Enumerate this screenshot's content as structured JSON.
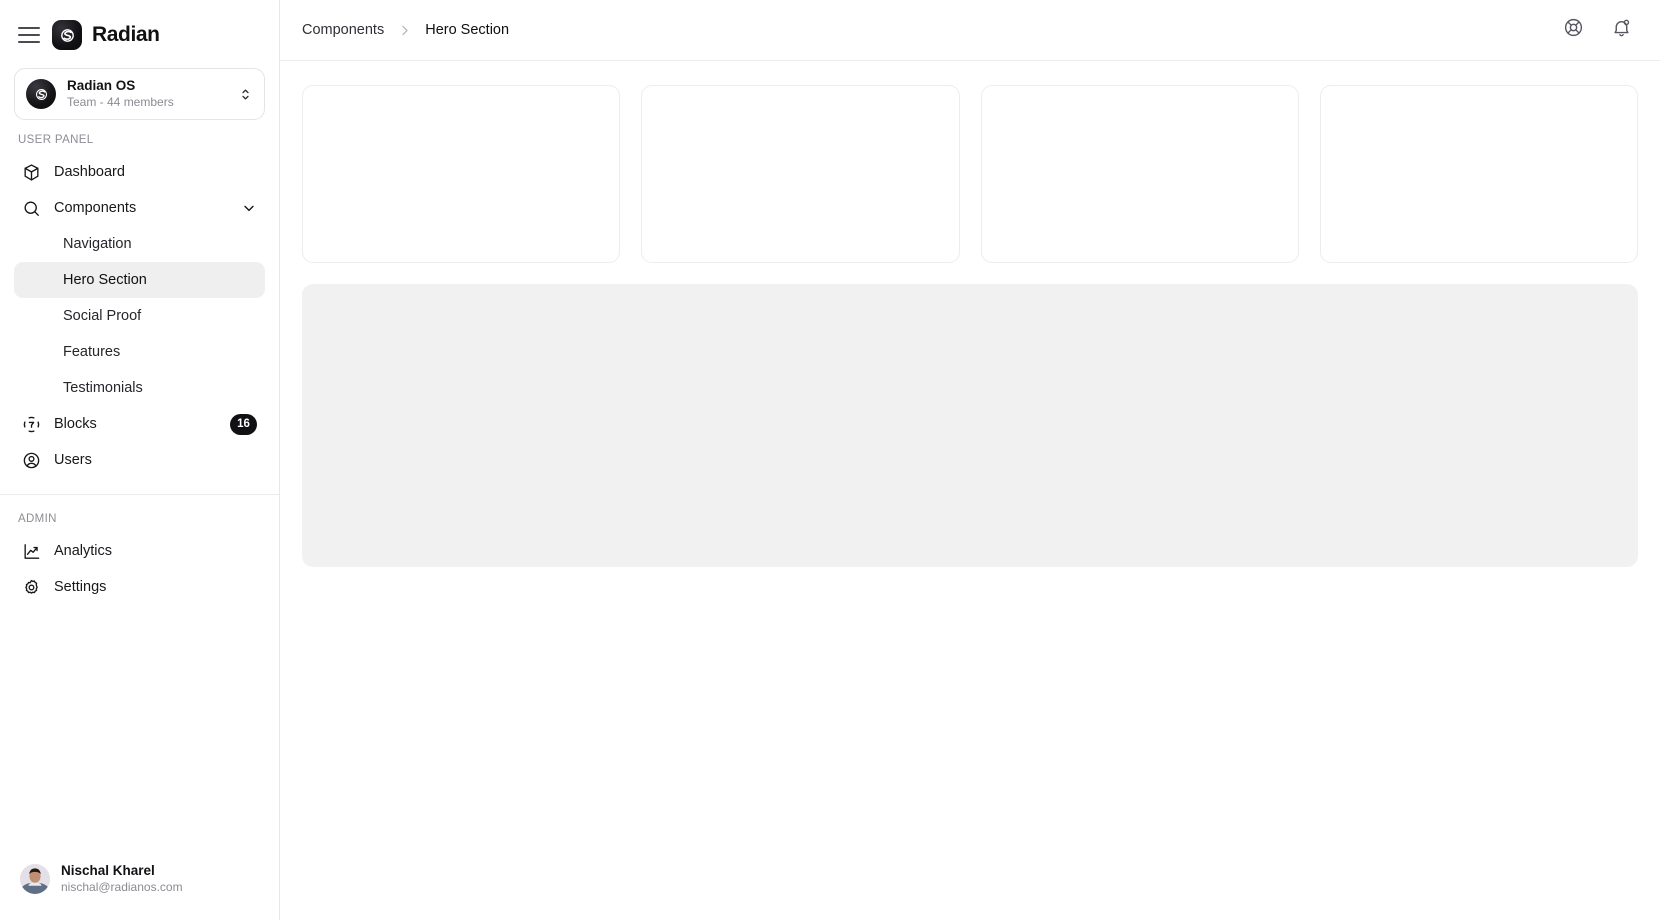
{
  "brand": {
    "name": "Radian",
    "logo_icon": "radian-swoosh-logo",
    "menu_icon": "hamburger-menu-icon"
  },
  "org_switcher": {
    "name": "Radian OS",
    "subtitle": "Team - 44 members",
    "avatar_icon": "radian-org-avatar",
    "chevron_icon": "chevron-up-down-icon"
  },
  "sidebar": {
    "sections": [
      {
        "label": "USER PANEL",
        "items": [
          {
            "label": "Dashboard",
            "icon": "box-icon"
          },
          {
            "label": "Components",
            "icon": "search-icon",
            "chevron": "chevron-down-icon",
            "expanded": true
          },
          {
            "label": "Blocks",
            "icon": "blocks-target-icon",
            "badge": "16"
          },
          {
            "label": "Users",
            "icon": "user-circle-icon"
          }
        ],
        "sub_items": [
          {
            "label": "Navigation",
            "active": false
          },
          {
            "label": "Hero Section",
            "active": true
          },
          {
            "label": "Social Proof",
            "active": false
          },
          {
            "label": "Features",
            "active": false
          },
          {
            "label": "Testimonials",
            "active": false
          }
        ]
      },
      {
        "label": "ADMIN",
        "items": [
          {
            "label": "Analytics",
            "icon": "trending-up-chart-icon"
          },
          {
            "label": "Settings",
            "icon": "gear-icon"
          }
        ]
      }
    ]
  },
  "footer_user": {
    "name": "Nischal Kharel",
    "email": "nischal@radianos.com",
    "avatar_icon": "user-photo-avatar"
  },
  "topbar": {
    "breadcrumb": [
      {
        "label": "Components",
        "current": false
      },
      {
        "label": "Hero Section",
        "current": true
      }
    ],
    "separator_icon": "chevron-right-icon",
    "actions": [
      {
        "icon": "life-buoy-help-icon",
        "name": "help-button"
      },
      {
        "icon": "bell-notification-icon",
        "name": "notifications-button"
      }
    ]
  },
  "content": {
    "skeleton_cards": [
      {
        "id": "card-1"
      },
      {
        "id": "card-2"
      },
      {
        "id": "card-3"
      },
      {
        "id": "card-4"
      }
    ],
    "skeleton_panel": {
      "id": "panel-1"
    }
  },
  "colors": {
    "accent": "#111114",
    "border": "#ededed",
    "skeleton": "#f1f1f1",
    "active_nav": "#efefef",
    "muted_text": "#8b8b92"
  }
}
